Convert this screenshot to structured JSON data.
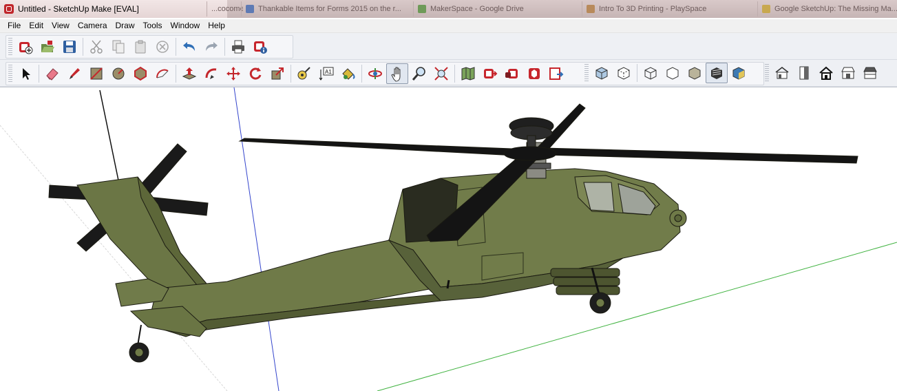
{
  "window": {
    "title": "Untitled - SketchUp Make [EVAL]"
  },
  "background_tabs": [
    {
      "label": "...cocomented on the card",
      "favicon_color": "#7b8a9b"
    },
    {
      "label": "Thankable Items for Forms 2015 on the r...",
      "favicon_color": "#5e7ab4"
    },
    {
      "label": "MakerSpace - Google Drive",
      "favicon_color": "#6e9a58"
    },
    {
      "label": "Intro To 3D Printing - PlaySpace",
      "favicon_color": "#b88a5b"
    },
    {
      "label": "Google SketchUp: The Missing Ma...",
      "favicon_color": "#c8a84f"
    }
  ],
  "menu": [
    "File",
    "Edit",
    "View",
    "Camera",
    "Draw",
    "Tools",
    "Window",
    "Help"
  ],
  "toolbar_standard": [
    {
      "name": "new-model-icon",
      "tip": "New",
      "enabled": true
    },
    {
      "name": "open-model-icon",
      "tip": "Open",
      "enabled": true
    },
    {
      "name": "save-model-icon",
      "tip": "Save",
      "enabled": true
    },
    {
      "name": "cut-icon",
      "tip": "Cut",
      "enabled": false
    },
    {
      "name": "copy-icon",
      "tip": "Copy",
      "enabled": false
    },
    {
      "name": "paste-icon",
      "tip": "Paste",
      "enabled": false
    },
    {
      "name": "erase-icon",
      "tip": "Erase",
      "enabled": false
    },
    {
      "name": "undo-icon",
      "tip": "Undo",
      "enabled": true
    },
    {
      "name": "redo-icon",
      "tip": "Redo",
      "enabled": false
    },
    {
      "name": "print-icon",
      "tip": "Print",
      "enabled": true
    },
    {
      "name": "model-info-icon",
      "tip": "Model Info",
      "enabled": true
    }
  ],
  "toolbar_tools": [
    "select-icon",
    "eraser-icon",
    "pencil-line-icon",
    "rectangle-icon",
    "circle-icon",
    "polygon-icon",
    "arc-icon",
    "push-pull-icon",
    "follow-me-icon",
    "move-icon",
    "rotate-icon",
    "scale-icon",
    "tape-measure-icon",
    "dimension-icon",
    "paint-bucket-icon",
    "orbit-icon",
    "pan-icon",
    "zoom-icon",
    "zoom-extents-icon",
    "add-location-icon",
    "get-models-icon",
    "share-model-icon",
    "share-component-icon",
    "send-to-layout-icon",
    "xray-style-icon",
    "back-edges-style-icon",
    "wireframe-style-icon",
    "hidden-line-style-icon",
    "shaded-style-icon",
    "shaded-textures-style-icon",
    "monochrome-style-icon",
    "iso-view-icon",
    "front-view-icon",
    "top-view-icon",
    "right-view-icon",
    "back-view-icon"
  ],
  "dimension_tool_label": "A1",
  "colors": {
    "helicopter_body": "#6f7a48",
    "helicopter_shadow": "#525b33",
    "rotor": "#1a1a1a",
    "axis_green": "#3fb23f",
    "axis_blue": "#3344cc"
  }
}
